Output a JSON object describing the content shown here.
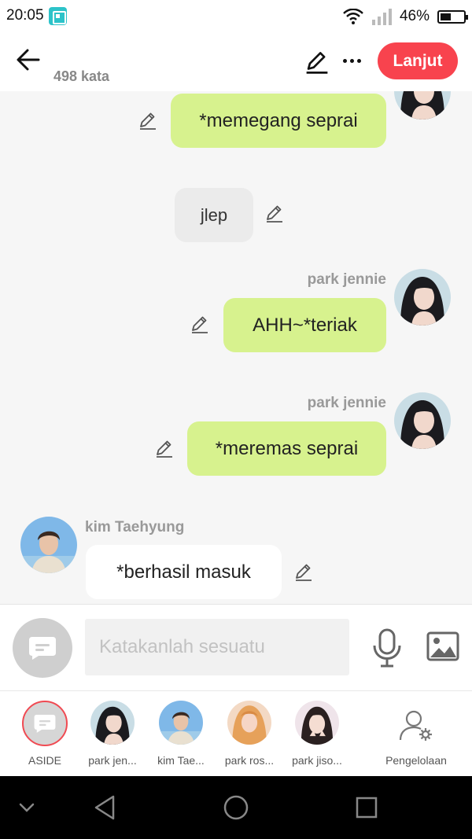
{
  "status_bar": {
    "time": "20:05",
    "battery_text": "46%",
    "battery_level": 0.46
  },
  "header": {
    "word_count": "498 kata",
    "next_label": "Lanjut"
  },
  "messages": [
    {
      "type": "user",
      "text": "*memegang seprai"
    },
    {
      "type": "narration",
      "text": "jlep"
    },
    {
      "type": "user",
      "sender": "park jennie",
      "text": "AHH~*teriak"
    },
    {
      "type": "user",
      "sender": "park jennie",
      "text": "*meremas seprai"
    },
    {
      "type": "other",
      "sender": "kim Taehyung",
      "text": "*berhasil masuk"
    }
  ],
  "input": {
    "placeholder": "Katakanlah sesuatu"
  },
  "characters": [
    {
      "label": "ASIDE"
    },
    {
      "label": "park jen..."
    },
    {
      "label": "kim Tae..."
    },
    {
      "label": "park ros..."
    },
    {
      "label": "park jiso..."
    },
    {
      "label": "Pengelolaan"
    }
  ],
  "colors": {
    "accent": "#f8434e",
    "user_bubble": "#d7f28e",
    "chat_bg": "#f6f6f6"
  },
  "icons": [
    "back-arrow-icon",
    "pencil-icon",
    "more-icon",
    "mic-icon",
    "image-icon",
    "chat-bubble-icon",
    "manage-user-icon",
    "nav-back-icon",
    "nav-home-icon",
    "nav-recents-icon"
  ]
}
